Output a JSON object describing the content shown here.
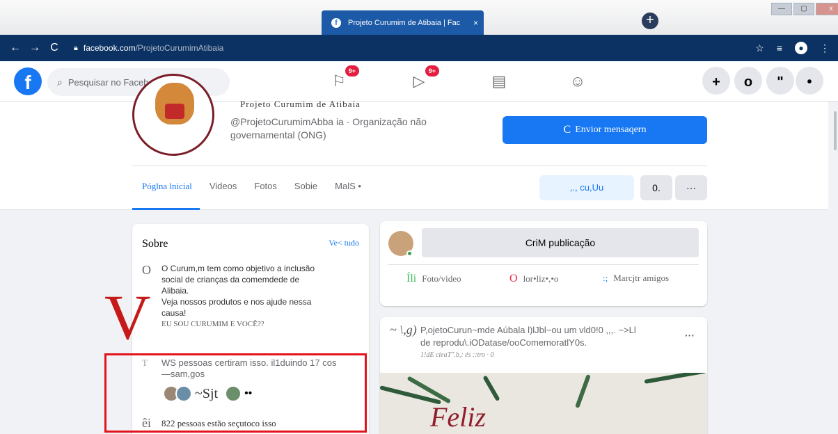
{
  "browser": {
    "tab_title": "Projeto Curumim de Atibaia | Fac",
    "tab_close": "×",
    "new_tab": "+",
    "url_host": "facebook.com",
    "url_path": "/ProjetoCurumimAtibaia",
    "win_min": "—",
    "win_max": "▢",
    "win_close": "x"
  },
  "fb": {
    "logo": "f",
    "search_placeholder": "Pesquisar no Facebook",
    "badge_pages": "9+",
    "badge_watch": "9+",
    "btn_create": "+",
    "btn_messenger": "o",
    "btn_notifications": "\"",
    "btn_account": "•"
  },
  "profile": {
    "name_line": "Projeto Curumim de Atibaia",
    "handle": "@ProjetoCurumimAbba",
    "category": "ia · Organização não governamental (ONG)",
    "message_button_icon": "C",
    "message_button": "Envior mensaqern",
    "tabs": [
      "Póglna lnicial",
      "Videos",
      "Fotos",
      "Sobie",
      "MalS •"
    ],
    "like_button": ",., cu,Uu",
    "btn2": "0.",
    "btn3": "···"
  },
  "about": {
    "title": "Sobre",
    "see_all": "Ve< tudo",
    "desc_icon": "O",
    "desc_lines": [
      "O Curum,m tem como objetivo a inclusão",
      "social de crianças da comemdede de",
      "Alibaia.",
      "Veja nossos produtos e nos ajude nessa",
      "causa!"
    ],
    "desc_caps": "EU SOU CURUMIM E VOCÊ??",
    "likes_icon": "T",
    "likes_text": "WS pessoas certiram isso. il1duindo 17 cos",
    "likes_text2": "—sam,gos",
    "facepile_mid": "~Sjt",
    "followers_icon": "êi",
    "followers_text": "822 pessoas estão seçutoco isso",
    "overlay_letter": "V"
  },
  "create_post": {
    "button": "CriM publicação",
    "photo_icon": "Íli",
    "photo": "Foto/video",
    "feeling_icon": "O",
    "feeling": "lor•liz•,•o",
    "tag_icon": ":;",
    "tag": "Marcjtr amigos"
  },
  "post": {
    "avatar_glyph": "~ \\,g)",
    "head1": "P,ojetoCurun~mde Aúbala l)lJbl~ou um vld0!0 ,,,. ~>Ll",
    "head2": "de reprodu\\.iODatase/ooComemoratlY0s.",
    "head3": "1!dE cieaT\".b,: és ::tro · 0",
    "more": "···",
    "image_text": "Feliz"
  },
  "colors": {
    "fb_blue": "#1877f2",
    "browser_url_bar": "#0b3263",
    "annotation_red": "#e3121b"
  }
}
